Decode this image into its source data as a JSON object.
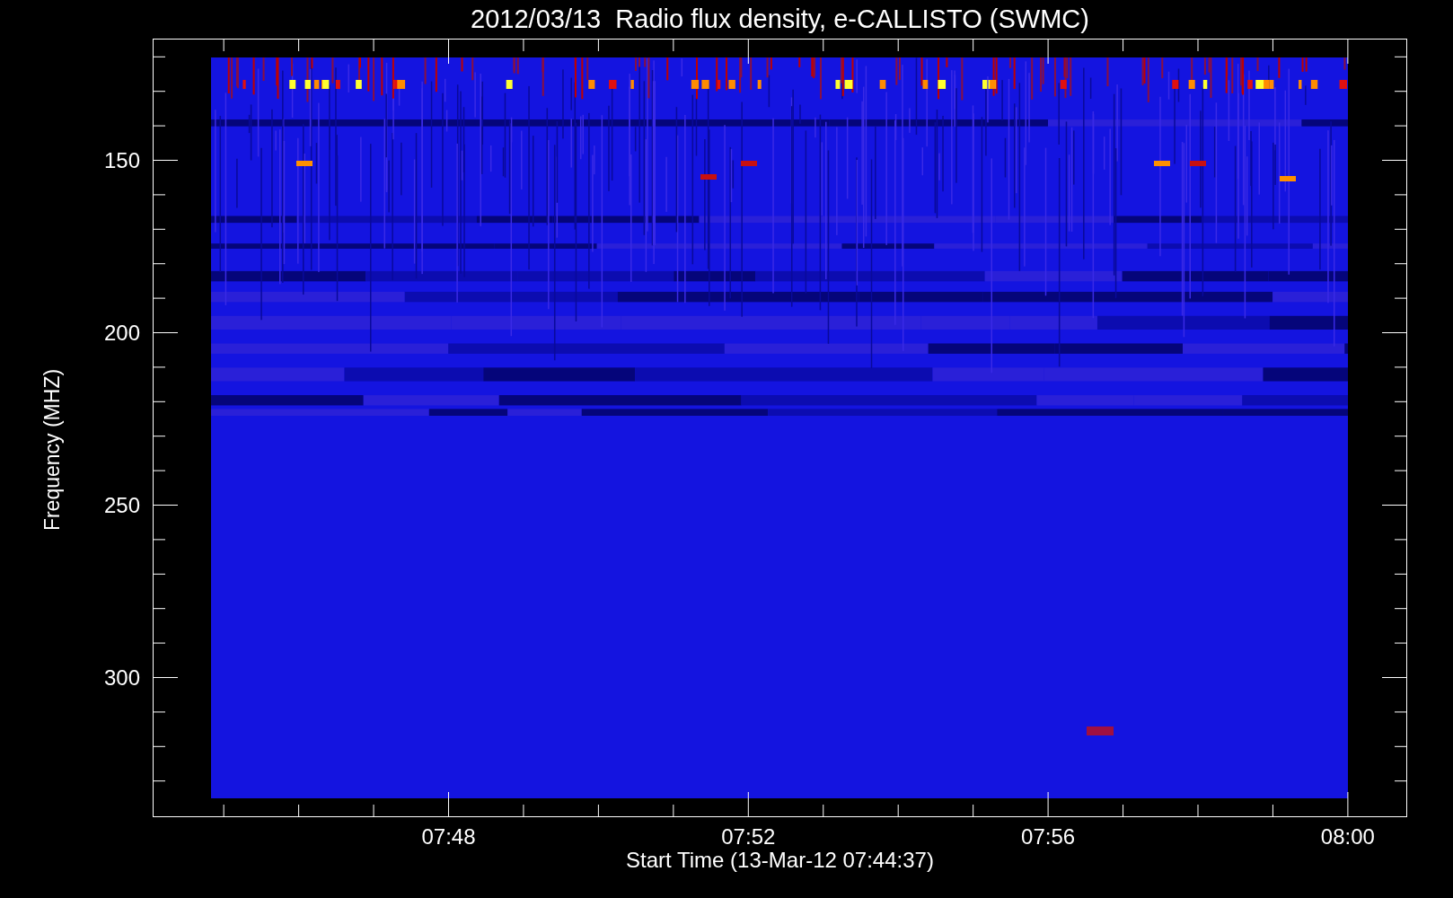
{
  "title": "2012/03/13  Radio flux density, e-CALLISTO (SWMC)",
  "y_axis": {
    "label": "Frequency (MHZ)",
    "ticks": [
      "150",
      "200",
      "250",
      "300"
    ]
  },
  "x_axis": {
    "label": "Start Time (13-Mar-12 07:44:37)",
    "ticks": [
      "07:48",
      "07:52",
      "07:56",
      "08:00"
    ]
  }
}
